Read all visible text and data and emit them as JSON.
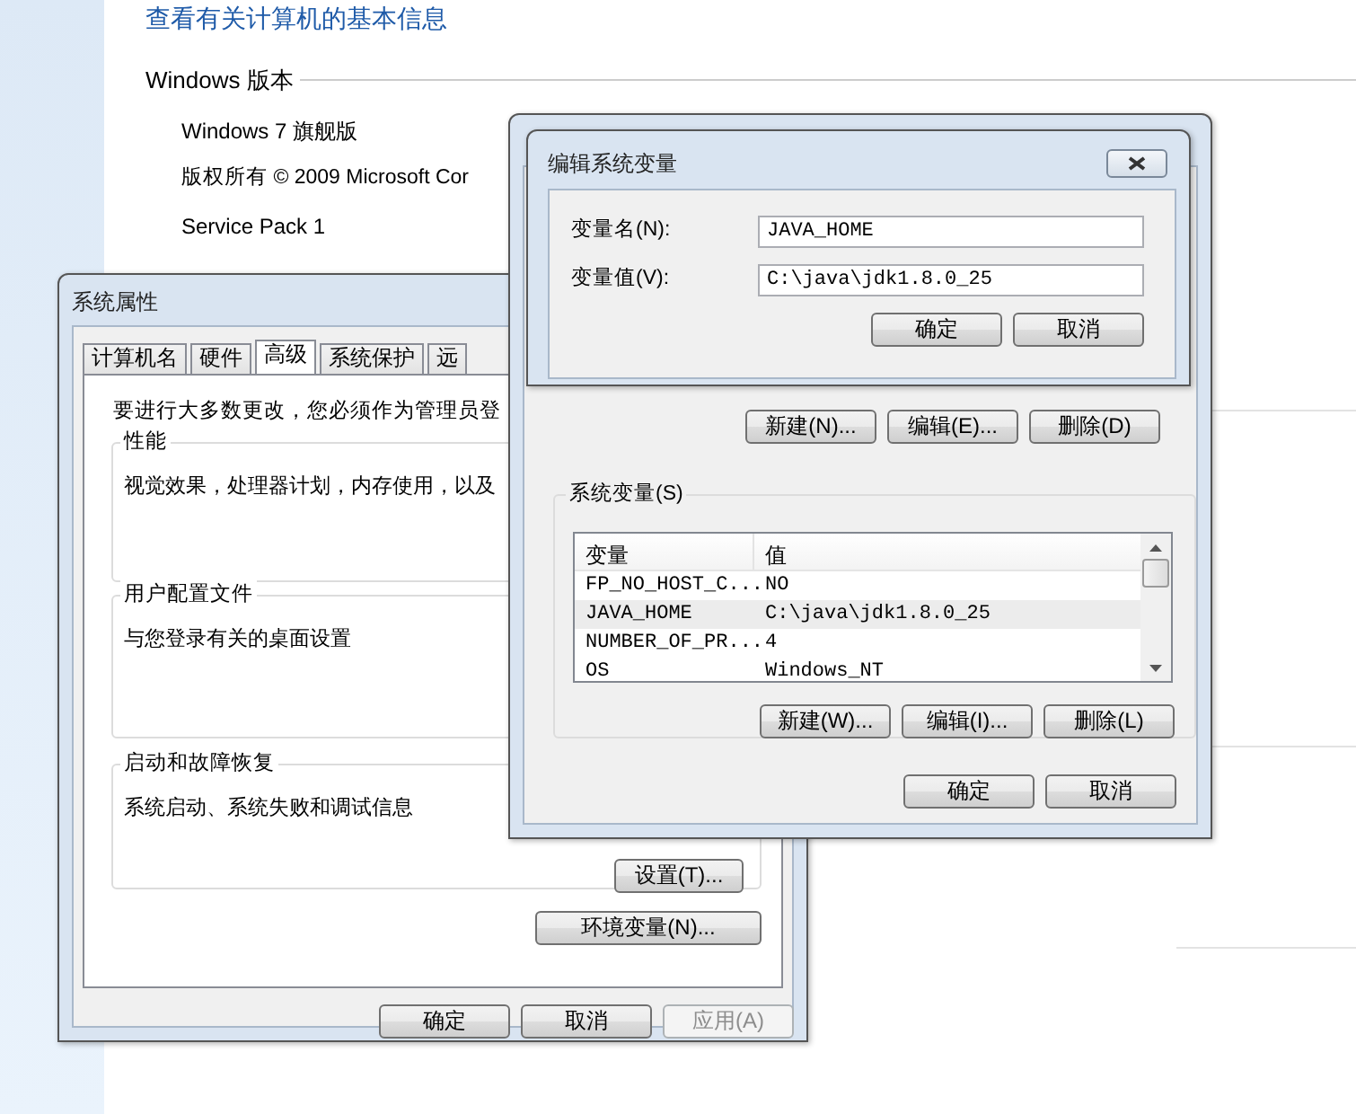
{
  "page": {
    "heading": "查看有关计算机的基本信息",
    "section": "Windows 版本",
    "edition": "Windows 7 旗舰版",
    "copyright": "版权所有 © 2009 Microsoft Cor",
    "service_pack": "Service Pack 1"
  },
  "system_properties": {
    "title": "系统属性",
    "tabs": [
      {
        "label": "计算机名",
        "selected": false
      },
      {
        "label": "硬件",
        "selected": false
      },
      {
        "label": "高级",
        "selected": true
      },
      {
        "label": "系统保护",
        "selected": false
      },
      {
        "label": "远",
        "selected": false
      }
    ],
    "notice": "要进行大多数更改，您必须作为管理员登",
    "groups": [
      {
        "title": "性能",
        "text": "视觉效果，处理器计划，内存使用，以及"
      },
      {
        "title": "用户配置文件",
        "text": "与您登录有关的桌面设置"
      },
      {
        "title": "启动和故障恢复",
        "text": "系统启动、系统失败和调试信息",
        "button": "设置(T)..."
      }
    ],
    "env_button": "环境变量(N)...",
    "buttons": [
      {
        "label": "确定",
        "disabled": false
      },
      {
        "label": "取消",
        "disabled": false
      },
      {
        "label": "应用(A)",
        "disabled": true
      }
    ]
  },
  "environment_variables": {
    "user_buttons": [
      "新建(N)...",
      "编辑(E)...",
      "删除(D)"
    ],
    "system_group": {
      "title": "系统变量(S)",
      "columns": [
        "变量",
        "值"
      ],
      "rows": [
        {
          "name": "FP_NO_HOST_C...",
          "value": "NO",
          "selected": false
        },
        {
          "name": "JAVA_HOME",
          "value": "C:\\java\\jdk1.8.0_25",
          "selected": true
        },
        {
          "name": "NUMBER_OF_PR...",
          "value": "4",
          "selected": false
        },
        {
          "name": "OS",
          "value": "Windows_NT",
          "selected": false
        }
      ],
      "buttons": [
        "新建(W)...",
        "编辑(I)...",
        "删除(L)"
      ]
    },
    "buttons": [
      "确定",
      "取消"
    ]
  },
  "edit_dialog": {
    "title": "编辑系统变量",
    "fields": [
      {
        "label": "变量名(N):",
        "value": "JAVA_HOME"
      },
      {
        "label": "变量值(V):",
        "value": "C:\\java\\jdk1.8.0_25"
      }
    ],
    "buttons": [
      "确定",
      "取消"
    ]
  }
}
